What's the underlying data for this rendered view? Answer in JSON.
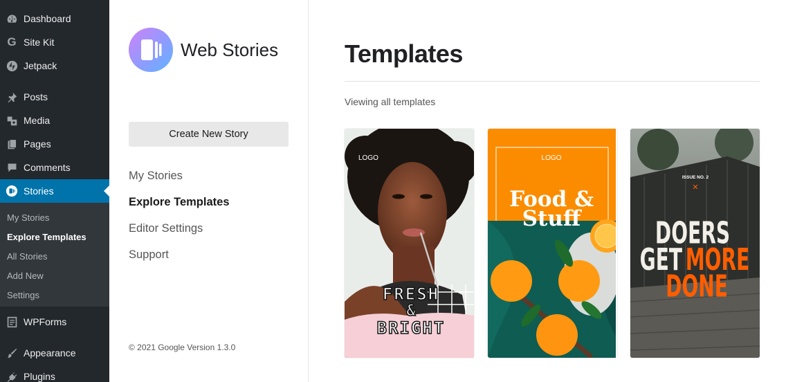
{
  "wp_menu": {
    "items": [
      {
        "label": "Dashboard",
        "icon": "dashboard-icon"
      },
      {
        "label": "Site Kit",
        "icon": "google-g-icon"
      },
      {
        "label": "Jetpack",
        "icon": "jetpack-icon"
      },
      {
        "label": "Posts",
        "icon": "pin-icon"
      },
      {
        "label": "Media",
        "icon": "media-icon"
      },
      {
        "label": "Pages",
        "icon": "pages-icon"
      },
      {
        "label": "Comments",
        "icon": "comment-icon"
      },
      {
        "label": "Stories",
        "icon": "stories-icon"
      },
      {
        "label": "WPForms",
        "icon": "wpforms-icon"
      },
      {
        "label": "Appearance",
        "icon": "paintbrush-icon"
      },
      {
        "label": "Plugins",
        "icon": "plug-icon"
      }
    ],
    "submenu": [
      "My Stories",
      "Explore Templates",
      "All Stories",
      "Add New",
      "Settings"
    ]
  },
  "web_stories": {
    "brand": "Web Stories",
    "create_button": "Create New Story",
    "nav": [
      "My Stories",
      "Explore Templates",
      "Editor Settings",
      "Support"
    ],
    "footer": "© 2021 Google Version 1.3.0"
  },
  "main": {
    "title": "Templates",
    "viewing": "Viewing all templates",
    "templates": [
      {
        "logo": "LOGO",
        "line1": "FRESH",
        "line2": "&",
        "line3": "BRIGHT"
      },
      {
        "logo": "LOGO",
        "line1": "Food &",
        "line2": "Stuff"
      },
      {
        "issue": "ISSUE NO. 2",
        "mark": "✕",
        "line1": "DOERS",
        "line2a": "GET",
        "line2b": "MORE",
        "line3": "DONE"
      }
    ]
  },
  "colors": {
    "wp_sidebar": "#23282d",
    "wp_active": "#0073aa",
    "food_orange": "#fb8c00",
    "doers_orange": "#ff5e00"
  }
}
